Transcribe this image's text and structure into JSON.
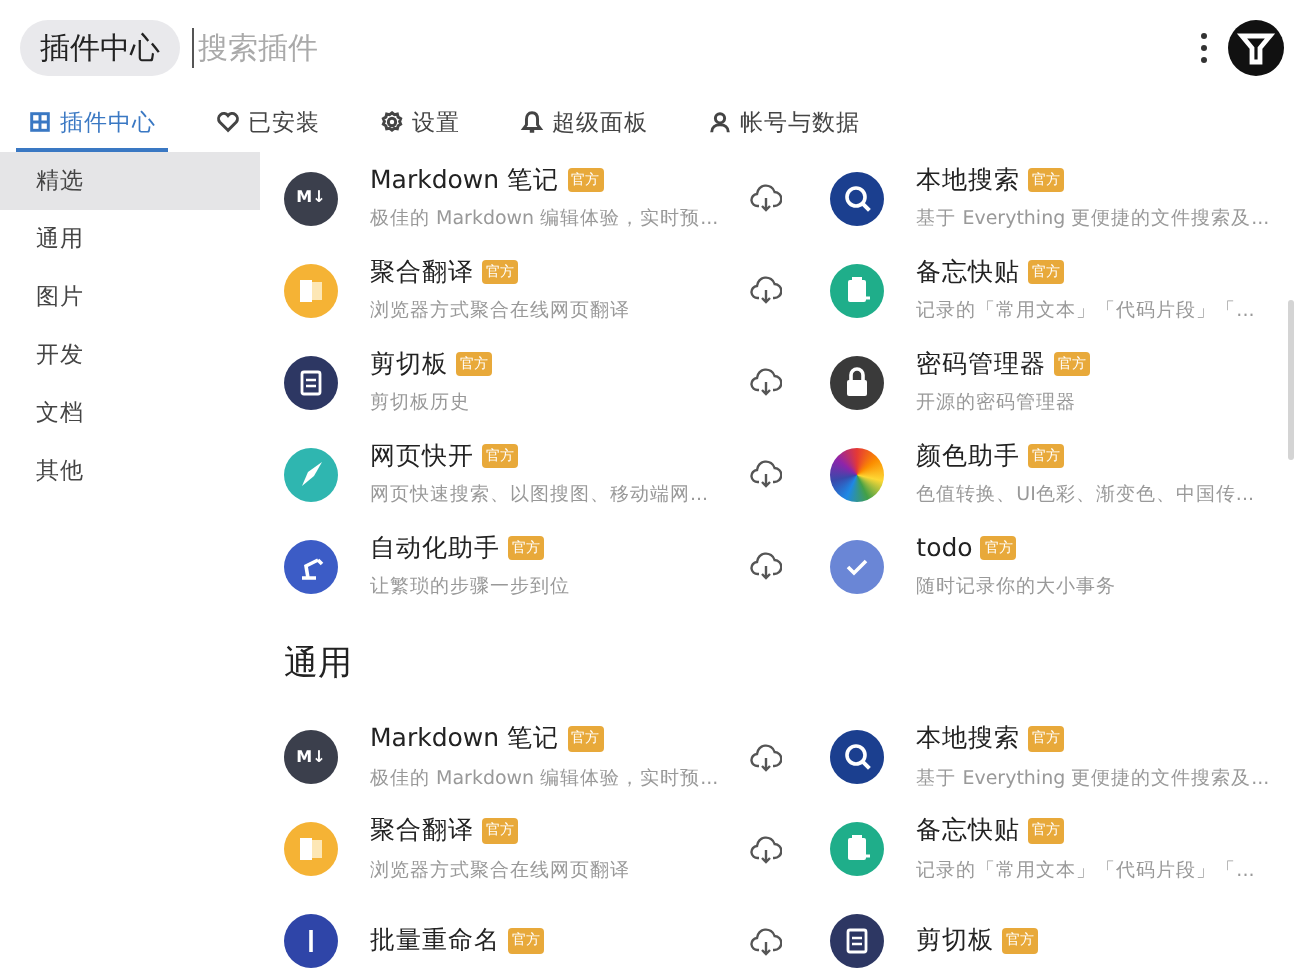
{
  "header": {
    "title": "插件中心",
    "search": {
      "placeholder": "搜索插件"
    }
  },
  "tabs": [
    {
      "label": "插件中心",
      "selected": true
    },
    {
      "label": "已安装",
      "selected": false
    },
    {
      "label": "设置",
      "selected": false
    },
    {
      "label": "超级面板",
      "selected": false
    },
    {
      "label": "帐号与数据",
      "selected": false
    }
  ],
  "sidebar": {
    "items": [
      {
        "label": "精选",
        "selected": true
      },
      {
        "label": "通用",
        "selected": false
      },
      {
        "label": "图片",
        "selected": false
      },
      {
        "label": "开发",
        "selected": false
      },
      {
        "label": "文档",
        "selected": false
      },
      {
        "label": "其他",
        "selected": false
      }
    ]
  },
  "sections": [
    {
      "items": [
        {
          "name": "Markdown 笔记",
          "badge": "官方",
          "description": "极佳的 Markdown 编辑体验，实时预...",
          "kind": "markdown",
          "icon_text": "M↓"
        },
        {
          "name": "本地搜索",
          "badge": "官方",
          "description": "基于 Everything 更便捷的文件搜索及...",
          "kind": "search"
        },
        {
          "name": "聚合翻译",
          "badge": "官方",
          "description": "浏览器方式聚合在线网页翻译",
          "kind": "translate"
        },
        {
          "name": "备忘快贴",
          "badge": "官方",
          "description": "记录的「常用文本」「代码片段」「...",
          "kind": "note"
        },
        {
          "name": "剪切板",
          "badge": "官方",
          "description": "剪切板历史",
          "kind": "clipboard"
        },
        {
          "name": "密码管理器",
          "badge": "官方",
          "description": "开源的密码管理器",
          "kind": "lock"
        },
        {
          "name": "网页快开",
          "badge": "官方",
          "description": "网页快速搜索、以图搜图、移动端网...",
          "kind": "rocket"
        },
        {
          "name": "颜色助手",
          "badge": "官方",
          "description": "色值转换、UI色彩、渐变色、中国传...",
          "kind": "color"
        },
        {
          "name": "自动化助手",
          "badge": "官方",
          "description": "让繁琐的步骤一步到位",
          "kind": "robot"
        },
        {
          "name": "todo",
          "badge": "官方",
          "description": "随时记录你的大小事务",
          "kind": "check"
        }
      ]
    },
    {
      "title": "通用",
      "items": [
        {
          "name": "Markdown 笔记",
          "badge": "官方",
          "description": "极佳的 Markdown 编辑体验，实时预...",
          "kind": "markdown",
          "icon_text": "M↓"
        },
        {
          "name": "本地搜索",
          "badge": "官方",
          "description": "基于 Everything 更便捷的文件搜索及...",
          "kind": "search"
        },
        {
          "name": "聚合翻译",
          "badge": "官方",
          "description": "浏览器方式聚合在线网页翻译",
          "kind": "translate"
        },
        {
          "name": "备忘快贴",
          "badge": "官方",
          "description": "记录的「常用文本」「代码片段」「...",
          "kind": "note"
        },
        {
          "name": "批量重命名",
          "badge": "官方",
          "kind": "rename"
        },
        {
          "name": "剪切板",
          "badge": "官方",
          "kind": "clipboard"
        }
      ]
    }
  ]
}
